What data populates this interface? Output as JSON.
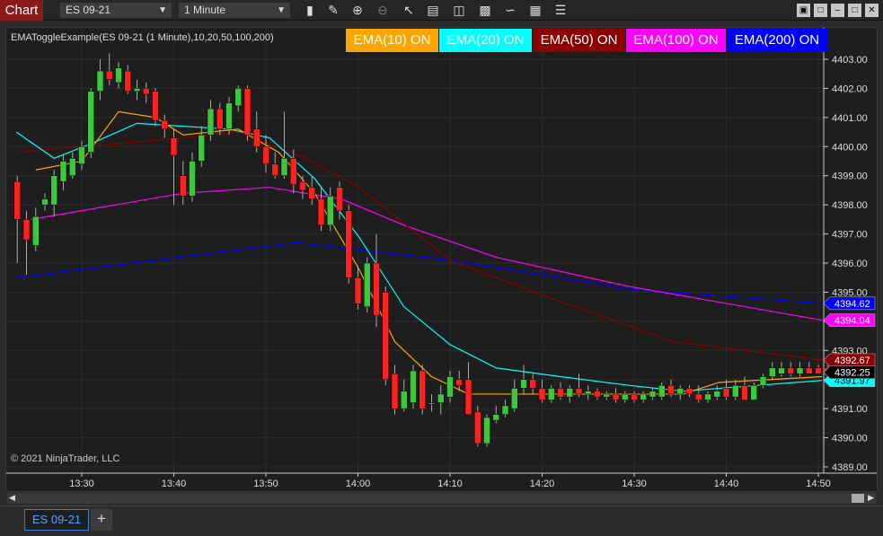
{
  "window": {
    "title": "Chart",
    "instrument": "ES 09-21",
    "interval": "1 Minute"
  },
  "toolbar": [
    "bars-icon",
    "pencil-icon",
    "zoom-in-icon",
    "zoom-out-icon",
    "pointer-icon",
    "data-box-icon",
    "properties-icon",
    "indicators-icon",
    "strategies-icon",
    "templates-icon",
    "list-icon"
  ],
  "indicator_label": "EMAToggleExample(ES 09-21 (1 Minute),10,20,50,100,200)",
  "buttons": [
    {
      "label": "EMA(10) ON",
      "bg": "#ffa500",
      "fg": "#ffffff"
    },
    {
      "label": "EMA(20) ON",
      "bg": "#00ffff",
      "fg": "#ffffff"
    },
    {
      "label": "EMA(50) ON",
      "bg": "#8b0000",
      "fg": "#ffffff"
    },
    {
      "label": "EMA(100) ON",
      "bg": "#ff00ff",
      "fg": "#ffffff"
    },
    {
      "label": "EMA(200) ON",
      "bg": "#0000ff",
      "fg": "#ffffff"
    }
  ],
  "copyright": "© 2021 NinjaTrader, LLC",
  "tabs": {
    "active": "ES 09-21",
    "add": "+"
  },
  "chart_data": {
    "type": "candlestick",
    "y_ticks": [
      "4403.00",
      "4402.00",
      "4401.00",
      "4400.00",
      "4399.00",
      "4398.00",
      "4397.00",
      "4396.00",
      "4395.00",
      "4394.00",
      "4393.00",
      "4392.00",
      "4391.00",
      "4390.00",
      "4389.00"
    ],
    "x_ticks": [
      {
        "label": "13:30",
        "t": 30
      },
      {
        "label": "13:40",
        "t": 40
      },
      {
        "label": "13:50",
        "t": 50
      },
      {
        "label": "14:00",
        "t": 60
      },
      {
        "label": "14:10",
        "t": 70
      },
      {
        "label": "14:20",
        "t": 80
      },
      {
        "label": "14:30",
        "t": 90
      },
      {
        "label": "14:40",
        "t": 100
      },
      {
        "label": "14:50",
        "t": 110
      }
    ],
    "first_bar_minute": 23,
    "candles": [
      [
        4398.8,
        4399.0,
        4396.0,
        4397.5
      ],
      [
        4397.5,
        4397.8,
        4395.6,
        4396.8
      ],
      [
        4396.6,
        4397.9,
        4396.4,
        4397.6
      ],
      [
        4398.0,
        4398.4,
        4397.8,
        4398.2
      ],
      [
        4398.0,
        4399.2,
        4397.6,
        4399.0
      ],
      [
        4398.8,
        4399.7,
        4398.5,
        4399.5
      ],
      [
        4399.0,
        4399.8,
        4398.9,
        4399.6
      ],
      [
        4399.4,
        4400.2,
        4399.2,
        4400.0
      ],
      [
        4399.8,
        4402.0,
        4399.6,
        4401.9
      ],
      [
        4401.9,
        4403.0,
        4401.6,
        4402.6
      ],
      [
        4402.6,
        4403.2,
        4402.1,
        4402.3
      ],
      [
        4402.2,
        4402.9,
        4402.0,
        4402.7
      ],
      [
        4402.6,
        4402.8,
        4401.8,
        4401.9
      ],
      [
        4401.9,
        4402.3,
        4401.6,
        4402.0
      ],
      [
        4402.0,
        4402.2,
        4401.5,
        4401.8
      ],
      [
        4401.9,
        4402.0,
        4400.7,
        4400.9
      ],
      [
        4400.9,
        4401.1,
        4400.3,
        4400.6
      ],
      [
        4400.3,
        4400.6,
        4398.0,
        4399.7
      ],
      [
        4399.0,
        4399.5,
        4398.0,
        4398.3
      ],
      [
        4398.3,
        4399.8,
        4398.1,
        4399.5
      ],
      [
        4399.5,
        4400.7,
        4399.3,
        4400.4
      ],
      [
        4400.4,
        4401.6,
        4400.2,
        4401.3
      ],
      [
        4401.3,
        4401.5,
        4400.4,
        4400.6
      ],
      [
        4400.6,
        4401.7,
        4400.4,
        4401.5
      ],
      [
        4401.4,
        4402.1,
        4401.2,
        4402.0
      ],
      [
        4402.0,
        4402.1,
        4400.2,
        4400.4
      ],
      [
        4400.6,
        4401.2,
        4399.8,
        4400.0
      ],
      [
        4400.0,
        4400.4,
        4399.1,
        4399.4
      ],
      [
        4399.4,
        4399.8,
        4398.9,
        4399.0
      ],
      [
        4399.0,
        4401.2,
        4398.9,
        4399.6
      ],
      [
        4399.6,
        4399.9,
        4398.4,
        4398.7
      ],
      [
        4398.8,
        4399.0,
        4398.2,
        4398.5
      ],
      [
        4398.6,
        4399.0,
        4398.0,
        4398.2
      ],
      [
        4398.2,
        4398.6,
        4397.1,
        4397.3
      ],
      [
        4397.3,
        4398.6,
        4397.1,
        4398.3
      ],
      [
        4398.6,
        4398.8,
        4397.5,
        4397.8
      ],
      [
        4397.8,
        4398.0,
        4395.3,
        4395.5
      ],
      [
        4395.5,
        4395.9,
        4394.4,
        4394.6
      ],
      [
        4394.5,
        4396.2,
        4394.3,
        4396.0
      ],
      [
        4396.0,
        4397.0,
        4393.8,
        4394.2
      ],
      [
        4395.0,
        4395.2,
        4391.8,
        4392.0
      ],
      [
        4392.2,
        4392.5,
        4390.8,
        4391.0
      ],
      [
        4391.0,
        4392.0,
        4390.9,
        4391.6
      ],
      [
        4391.2,
        4392.5,
        4391.0,
        4392.3
      ],
      [
        4392.3,
        4392.5,
        4390.8,
        4391.0
      ],
      [
        4391.2,
        4391.5,
        4390.9,
        4391.2
      ],
      [
        4391.2,
        4391.8,
        4390.8,
        4391.5
      ],
      [
        4391.4,
        4392.3,
        4391.2,
        4392.1
      ],
      [
        4392.0,
        4392.3,
        4391.6,
        4391.8
      ],
      [
        4392.0,
        4392.6,
        4390.8,
        4390.8
      ],
      [
        4390.9,
        4391.1,
        4389.7,
        4389.8
      ],
      [
        4389.8,
        4390.8,
        4389.7,
        4390.7
      ],
      [
        4390.6,
        4391.1,
        4390.5,
        4390.8
      ],
      [
        4390.8,
        4391.3,
        4390.7,
        4391.1
      ],
      [
        4391.0,
        4392.0,
        4390.9,
        4391.7
      ],
      [
        4391.7,
        4392.5,
        4391.5,
        4392.0
      ],
      [
        4392.0,
        4392.2,
        4391.5,
        4391.7
      ],
      [
        4391.7,
        4392.0,
        4391.2,
        4391.3
      ],
      [
        4391.3,
        4391.8,
        4391.2,
        4391.7
      ],
      [
        4391.7,
        4391.9,
        4391.3,
        4391.4
      ],
      [
        4391.4,
        4391.8,
        4391.2,
        4391.7
      ],
      [
        4391.7,
        4392.2,
        4391.4,
        4391.5
      ],
      [
        4391.5,
        4391.8,
        4391.3,
        4391.6
      ],
      [
        4391.6,
        4391.7,
        4391.3,
        4391.4
      ],
      [
        4391.4,
        4391.6,
        4391.3,
        4391.5
      ],
      [
        4391.5,
        4391.7,
        4391.2,
        4391.3
      ],
      [
        4391.3,
        4391.6,
        4391.2,
        4391.5
      ],
      [
        4391.5,
        4391.6,
        4391.2,
        4391.3
      ],
      [
        4391.3,
        4391.6,
        4391.2,
        4391.5
      ],
      [
        4391.4,
        4391.7,
        4391.3,
        4391.6
      ],
      [
        4391.4,
        4391.9,
        4391.3,
        4391.8
      ],
      [
        4391.8,
        4392.0,
        4391.4,
        4391.5
      ],
      [
        4391.5,
        4391.8,
        4391.3,
        4391.7
      ],
      [
        4391.7,
        4391.8,
        4391.4,
        4391.5
      ],
      [
        4391.5,
        4391.8,
        4391.2,
        4391.3
      ],
      [
        4391.3,
        4391.6,
        4391.2,
        4391.5
      ],
      [
        4391.4,
        4391.8,
        4391.3,
        4391.6
      ],
      [
        4391.7,
        4392.0,
        4391.3,
        4391.4
      ],
      [
        4391.4,
        4392.0,
        4391.3,
        4391.8
      ],
      [
        4391.8,
        4392.1,
        4391.3,
        4391.3
      ],
      [
        4391.3,
        4391.9,
        4391.3,
        4391.8
      ],
      [
        4391.8,
        4392.2,
        4391.7,
        4392.1
      ],
      [
        4392.1,
        4392.6,
        4392.0,
        4392.4
      ],
      [
        4392.2,
        4392.6,
        4392.1,
        4392.4
      ],
      [
        4392.4,
        4392.6,
        4392.1,
        4392.2
      ],
      [
        4392.2,
        4392.6,
        4392.1,
        4392.4
      ],
      [
        4392.4,
        4392.6,
        4392.2,
        4392.2
      ],
      [
        4392.4,
        4392.5,
        4392.2,
        4392.2
      ],
      [
        4392.4,
        4392.5,
        4392.2,
        4392.2
      ],
      [
        4392.2,
        4392.5,
        4392.1,
        4392.2
      ],
      [
        4392.2,
        4392.4,
        4392.1,
        4392.2
      ],
      [
        4392.1,
        4392.4,
        4392.1,
        4392.4
      ],
      [
        4392.1,
        4392.4,
        4392.1,
        4392.4
      ]
    ],
    "series": [
      {
        "name": "EMA(200)",
        "color": "#0000ff",
        "last": "4394.62",
        "points": [
          [
            22.9,
            4395.5
          ],
          [
            53.3,
            4396.7
          ],
          [
            70,
            4396.1
          ],
          [
            80,
            4395.6
          ],
          [
            89.4,
            4395.1
          ],
          [
            110.4,
            4394.62
          ]
        ]
      },
      {
        "name": "EMA(100)",
        "color": "#ff00ff",
        "last": "4394.04",
        "points": [
          [
            24.5,
            4397.5
          ],
          [
            41,
            4398.4
          ],
          [
            50.4,
            4398.6
          ],
          [
            58.2,
            4398.2
          ],
          [
            65,
            4397.3
          ],
          [
            75,
            4396.2
          ],
          [
            89.4,
            4395.2
          ],
          [
            110.4,
            4394.04
          ]
        ]
      },
      {
        "name": "EMA(50)",
        "color": "#8b0000",
        "last": "4392.67",
        "points": [
          [
            22.9,
            4399.8
          ],
          [
            41,
            4400.3
          ],
          [
            47,
            4400.5
          ],
          [
            54.3,
            4399.6
          ],
          [
            60.1,
            4398.6
          ],
          [
            70,
            4396.1
          ],
          [
            80,
            4394.9
          ],
          [
            94.3,
            4393.3
          ],
          [
            110.4,
            4392.67
          ]
        ]
      },
      {
        "name": "EMA(20)",
        "color": "#00ffff",
        "last": "4391.97",
        "points": [
          [
            22.9,
            4400.5
          ],
          [
            27,
            4399.6
          ],
          [
            31,
            4400.1
          ],
          [
            36,
            4400.8
          ],
          [
            46,
            4400.6
          ],
          [
            50.4,
            4400.3
          ],
          [
            55.3,
            4398.9
          ],
          [
            60.1,
            4396.9
          ],
          [
            65,
            4394.5
          ],
          [
            70,
            4393.2
          ],
          [
            75,
            4392.4
          ],
          [
            82,
            4392.1
          ],
          [
            89.4,
            4391.8
          ],
          [
            95.3,
            4391.6
          ],
          [
            110.4,
            4391.97
          ]
        ]
      },
      {
        "name": "EMA(10)",
        "color": "#ffa500",
        "last": "",
        "points": [
          [
            25,
            4399.2
          ],
          [
            30,
            4399.5
          ],
          [
            34,
            4401.2
          ],
          [
            38,
            4401.0
          ],
          [
            41,
            4400.4
          ],
          [
            47,
            4400.6
          ],
          [
            51.4,
            4399.8
          ],
          [
            55.3,
            4398.4
          ],
          [
            60.1,
            4395.8
          ],
          [
            64,
            4393.3
          ],
          [
            68,
            4392.1
          ],
          [
            72,
            4391.5
          ],
          [
            80,
            4391.5
          ],
          [
            89.4,
            4391.5
          ],
          [
            95.3,
            4391.5
          ],
          [
            99.2,
            4391.9
          ],
          [
            110.4,
            4392.1
          ]
        ]
      }
    ],
    "last_price": "4392.25"
  }
}
